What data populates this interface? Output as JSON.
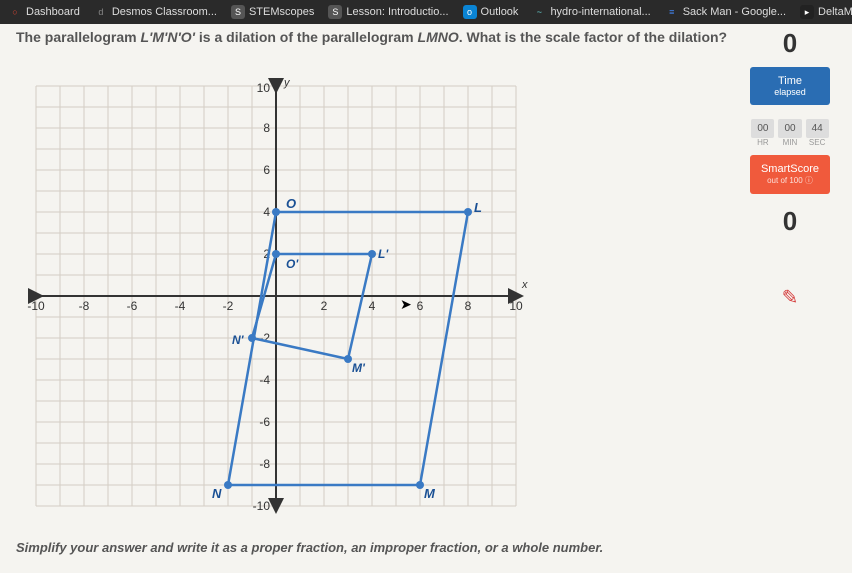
{
  "bookmarks": [
    {
      "label": "Dashboard",
      "icon": "○",
      "color": "#d43"
    },
    {
      "label": "Desmos Classroom...",
      "icon": "d",
      "color": "#888"
    },
    {
      "label": "STEMscopes",
      "icon": "S",
      "color": "#fff"
    },
    {
      "label": "Lesson: Introductio...",
      "icon": "S",
      "color": "#fff"
    },
    {
      "label": "Outlook",
      "icon": "o",
      "color": "#0a84d4"
    },
    {
      "label": "hydro-international...",
      "icon": "~",
      "color": "#6cc"
    },
    {
      "label": "Sack Man - Google...",
      "icon": "≡",
      "color": "#4285f4"
    },
    {
      "label": "DeltaMath",
      "icon": "▸",
      "color": "#222"
    }
  ],
  "question_prefix": "The parallelogram ",
  "question_var1": "L'M'N'O'",
  "question_mid": " is a dilation of the parallelogram ",
  "question_var2": "LMNO",
  "question_suffix": ". What is the scale factor of the dilation?",
  "instruction": "Simplify your answer and write it as a proper fraction, an improper fraction, or a whole number.",
  "counter": "0",
  "time_label": "Time",
  "time_sub": "elapsed",
  "time_vals": [
    "00",
    "00",
    "44"
  ],
  "time_units": [
    "HR",
    "MIN",
    "SEC"
  ],
  "smart_label": "SmartScore",
  "smart_sub": "out of 100 ⓘ",
  "score": "0",
  "chart_data": {
    "type": "coordinate-plane",
    "xlim": [
      -10,
      10
    ],
    "ylim": [
      -10,
      10
    ],
    "grid": true,
    "points_original": {
      "O": [
        0,
        4
      ],
      "L": [
        8,
        4
      ],
      "M": [
        6,
        -9
      ],
      "N": [
        -2,
        -9
      ]
    },
    "points_dilated": {
      "O'": [
        0,
        2
      ],
      "L'": [
        4,
        2
      ],
      "M'": [
        3,
        -3
      ],
      "N'": [
        -1,
        -2
      ]
    },
    "axis_ticks_x": [
      -10,
      -8,
      -6,
      -4,
      -2,
      2,
      4,
      6,
      8,
      10
    ],
    "axis_ticks_y": [
      -10,
      -8,
      -6,
      -4,
      -2,
      2,
      4,
      6,
      8,
      10
    ],
    "xlabel": "x",
    "ylabel": "y"
  }
}
